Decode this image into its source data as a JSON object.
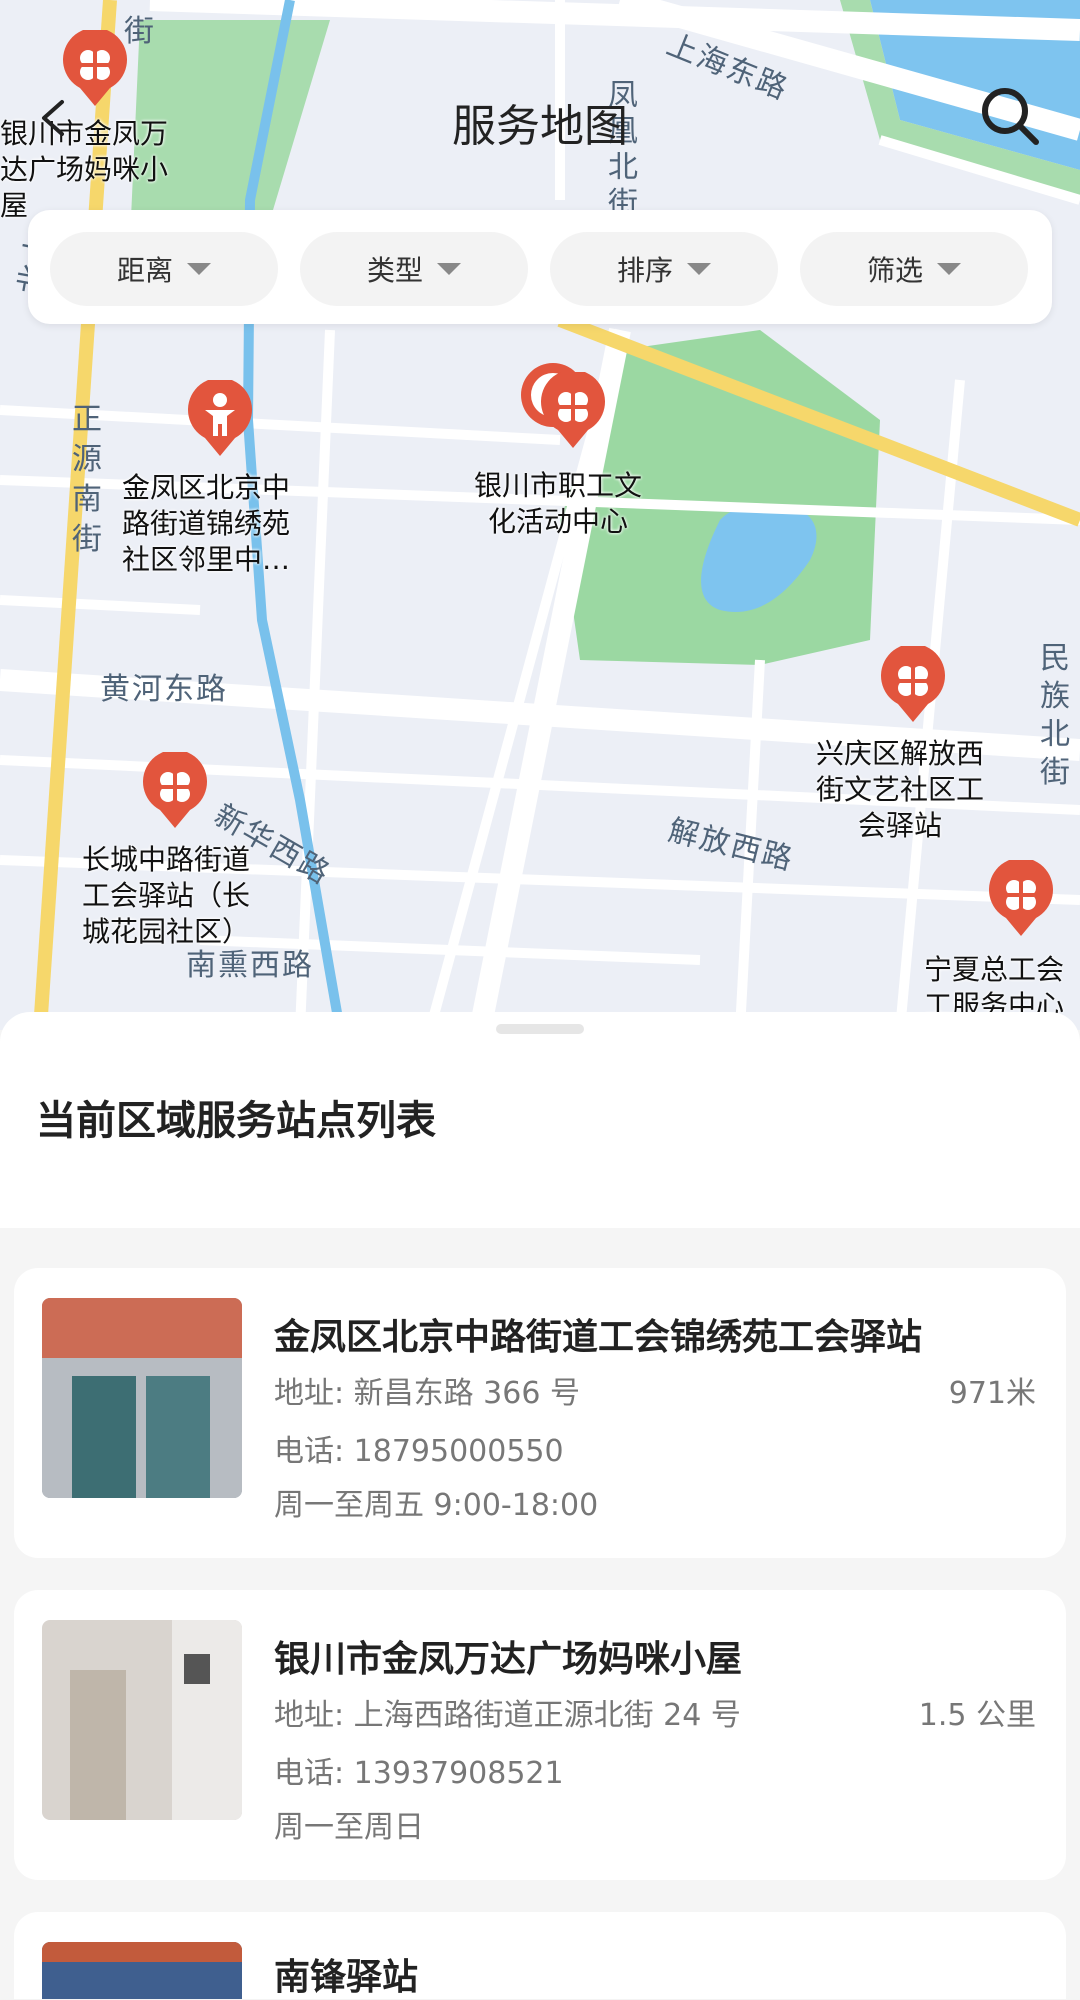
{
  "header": {
    "title": "服务地图"
  },
  "filters": [
    {
      "label": "距离"
    },
    {
      "label": "类型"
    },
    {
      "label": "排序"
    },
    {
      "label": "筛选"
    }
  ],
  "map": {
    "roads": [
      "上海东路",
      "凤凰北街",
      "正源南街",
      "黄河东路",
      "新华西路",
      "解放西路",
      "民族北街",
      "南熏西路",
      "街",
      "北大"
    ],
    "pois": [
      {
        "label": "银川市金凤万达广场妈咪小屋",
        "lines": [
          "银川市金凤万",
          "达广场妈咪小",
          "屋"
        ]
      },
      {
        "label": "金凤区北京中路街道锦绣苑社区邻里中…",
        "lines": [
          "金凤区北京中",
          "路街道锦绣苑",
          "社区邻里中…"
        ]
      },
      {
        "label": "银川市职工文化活动中心",
        "lines": [
          "银川市职工文",
          "化活动中心"
        ]
      },
      {
        "label": "兴庆区解放西街文艺社区工会驿站",
        "lines": [
          "兴庆区解放西",
          "街文艺社区工",
          "会驿站"
        ]
      },
      {
        "label": "长城中路街道工会驿站（长城花园社区）",
        "lines": [
          "长城中路街道",
          "工会驿站（长",
          "城花园社区）"
        ]
      },
      {
        "label": "宁夏总工会工服务中心",
        "lines": [
          "宁夏总工会",
          "工服务中心"
        ]
      }
    ]
  },
  "list": {
    "title": "当前区域服务站点列表",
    "items": [
      {
        "name": "金凤区北京中路街道工会锦绣苑工会驿站",
        "address": "地址: 新昌东路 366 号",
        "distance": "971米",
        "phone": "电话: 18795000550",
        "hours": "周一至周五 9:00-18:00"
      },
      {
        "name": "银川市金凤万达广场妈咪小屋",
        "address": "地址: 上海西路街道正源北街 24 号",
        "distance": "1.5 公里",
        "phone": "电话: 13937908521",
        "hours": "周一至周日"
      },
      {
        "name": "南锋驿站",
        "address": "",
        "distance": "",
        "phone": "",
        "hours": ""
      }
    ]
  },
  "colors": {
    "marker": "#e2553d",
    "park": "#9bd8a2",
    "water": "#7ec4ef",
    "major_road": "#f6d76b"
  }
}
